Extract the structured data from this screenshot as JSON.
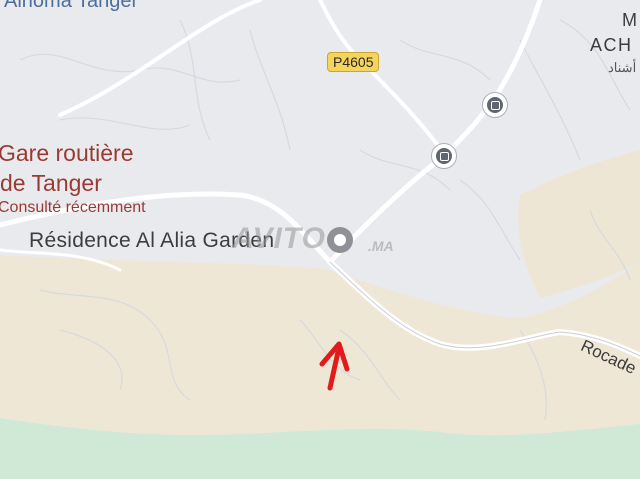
{
  "map": {
    "top_place_label": "Alhoma Tanger",
    "bus_station_label_line1": "Gare routière",
    "bus_station_label_line2": "de Tanger",
    "recent_label": "Consulté récemment",
    "pinned_place_label": "Résidence Al Alia Garden",
    "district_label_line1": "M",
    "district_label_line2": "ACH",
    "district_label_arabic": "أشناد",
    "road_badge": "P4605",
    "road_label": "Rocade",
    "watermark": "AVITO",
    "watermark_suffix": ".MA",
    "icons": [
      "bus-stop-icon",
      "bus-stop-icon",
      "place-pin-icon",
      "arrow-up-icon"
    ],
    "colors": {
      "urban_background": "#e9eaee",
      "open_land": "#efe7d6",
      "forest": "#cfe9d6",
      "roads": "#ffffff",
      "arrow": "#e11b1b",
      "label_poi": "#9a3b33",
      "road_badge": "#f4d45a"
    }
  }
}
